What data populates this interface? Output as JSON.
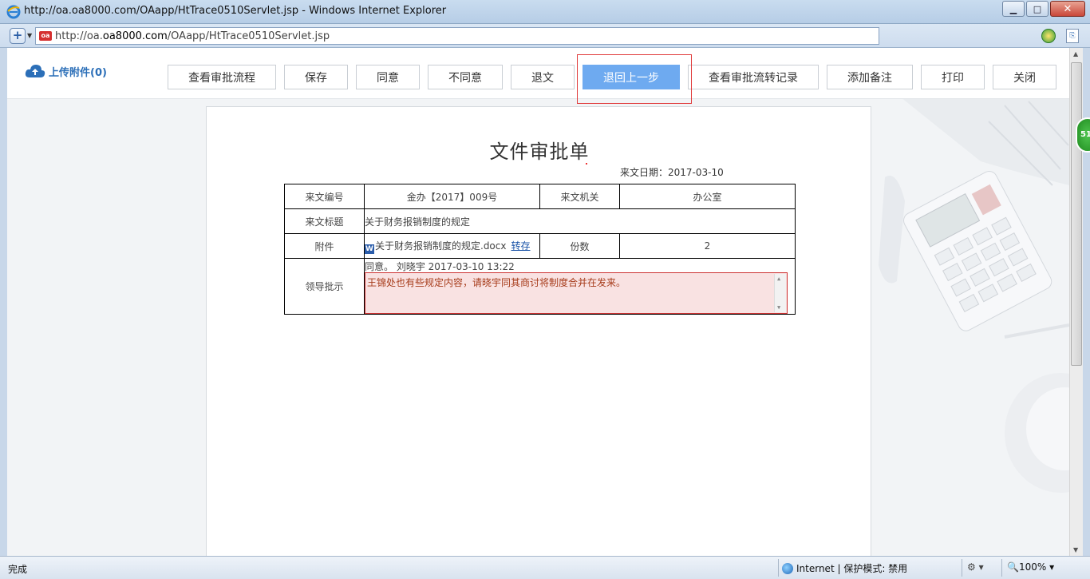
{
  "window": {
    "title": "http://oa.oa8000.com/OAapp/HtTrace0510Servlet.jsp - Windows Internet Explorer",
    "minimize": "▁",
    "maximize": "□",
    "close": "✕"
  },
  "address": {
    "url_prefix": "http://oa.",
    "url_domain": "oa8000.com",
    "url_suffix": "/OAapp/HtTrace0510Servlet.jsp",
    "site_icon": "oa"
  },
  "toolbar": {
    "upload_label": "上传附件(0)",
    "buttons": [
      {
        "label": "查看审批流程"
      },
      {
        "label": "保存"
      },
      {
        "label": "同意"
      },
      {
        "label": "不同意"
      },
      {
        "label": "退文"
      },
      {
        "label": "退回上一步",
        "active": true
      },
      {
        "label": "查看审批流转记录"
      },
      {
        "label": "添加备注"
      },
      {
        "label": "打印"
      },
      {
        "label": "关闭"
      }
    ]
  },
  "document": {
    "title": "文件审批单",
    "date_line": "来文日期：2017-03-10",
    "labels": {
      "number": "来文编号",
      "org": "来文机关",
      "subject": "来文标题",
      "attachment": "附件",
      "copies": "份数",
      "instruction": "领导批示"
    },
    "values": {
      "number": "金办【2017】009号",
      "org": "办公室",
      "subject": "关于财务报销制度的规定",
      "attachment_file": "关于财务报销制度的规定.docx",
      "attachment_action": "转存",
      "copies": "2"
    },
    "approval": {
      "head": "同意。   刘晓宇 2017-03-10 13:22",
      "comment": "王锦处也有些规定内容，请晓宇同其商讨将制度合并在发来。"
    }
  },
  "statusbar": {
    "status": "完成",
    "zone": "Internet | 保护模式: 禁用",
    "zoom": "100%"
  },
  "badge": {
    "text": "51"
  },
  "colors": {
    "accent_button": "#6eaaf0",
    "highlight_border": "#e03a3a",
    "link": "#1b54a8",
    "upload": "#2c6fb8",
    "comment_bg": "#f9e2e2"
  }
}
